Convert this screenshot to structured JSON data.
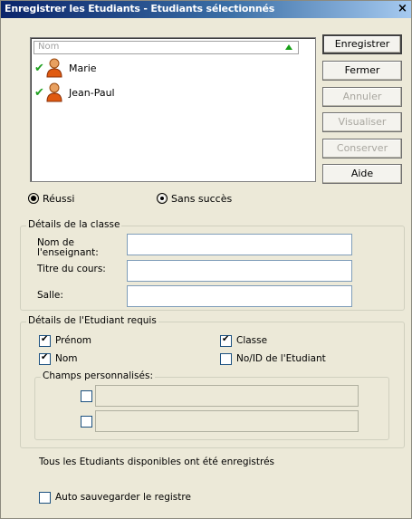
{
  "window": {
    "title": "Enregistrer les Etudiants - Etudiants sélectionnés",
    "close": "×"
  },
  "list": {
    "header": "Nom",
    "items": [
      {
        "label": "Marie"
      },
      {
        "label": "Jean-Paul"
      }
    ]
  },
  "buttons": {
    "save": "Enregistrer",
    "close": "Fermer",
    "cancel": "Annuler",
    "view": "Visualiser",
    "convert": "Conserver",
    "help": "Aide"
  },
  "status": {
    "success": "Réussi",
    "failure": "Sans succès"
  },
  "class_details": {
    "legend": "Détails de la classe",
    "teacher_label": "Nom de l'enseignant:",
    "teacher_value": "",
    "course_label": "Titre du cours:",
    "course_value": "",
    "room_label": "Salle:",
    "room_value": ""
  },
  "student_details": {
    "legend": "Détails de l'Etudiant requis",
    "first_name": {
      "label": "Prénom",
      "checked": true
    },
    "last_name": {
      "label": "Nom",
      "checked": true
    },
    "class": {
      "label": "Classe",
      "checked": true
    },
    "student_id": {
      "label": "No/ID de l'Etudiant",
      "checked": false
    },
    "custom_legend": "Champs personnalisés:"
  },
  "message": "Tous les Etudiants disponibles ont été enregistrés",
  "autosave": {
    "label": "Auto sauvegarder le registre",
    "checked": false
  }
}
